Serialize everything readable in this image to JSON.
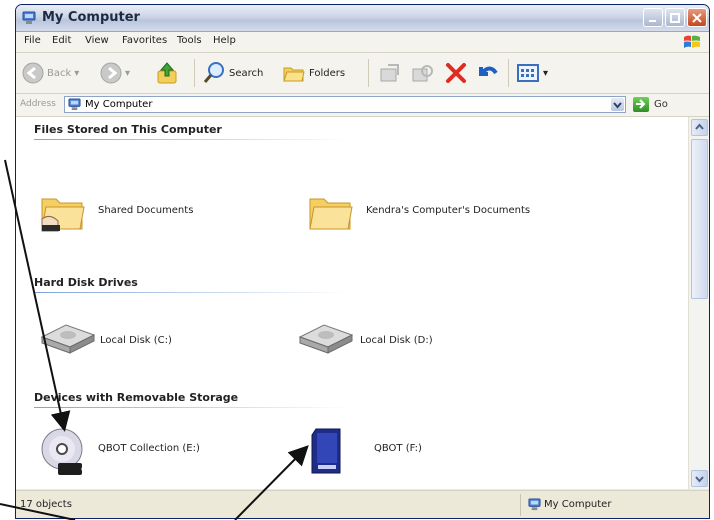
{
  "window": {
    "title": "My Computer"
  },
  "menu": [
    "File",
    "Edit",
    "View",
    "Favorites",
    "Tools",
    "Help"
  ],
  "toolbar": {
    "back": "Back",
    "search": "Search",
    "folders": "Folders"
  },
  "address": {
    "label": "Address",
    "value": "My Computer",
    "go": "Go"
  },
  "groups": {
    "files": {
      "title": "Files Stored on This Computer",
      "items": [
        "Shared Documents",
        "Kendra's Computer's Documents"
      ]
    },
    "hdd": {
      "title": "Hard Disk Drives",
      "items": [
        "Local Disk (C:)",
        "Local Disk (D:)"
      ]
    },
    "removable": {
      "title": "Devices with Removable Storage",
      "items": [
        "QBOT Collection (E:)",
        "QBOT (F:)"
      ],
      "cd_badge": "CD-R"
    }
  },
  "status": {
    "left": "17 objects",
    "right": "My Computer"
  },
  "colors": {
    "arrow": "#111111",
    "close": "#c24820",
    "group_line": "#7ea3d8"
  }
}
